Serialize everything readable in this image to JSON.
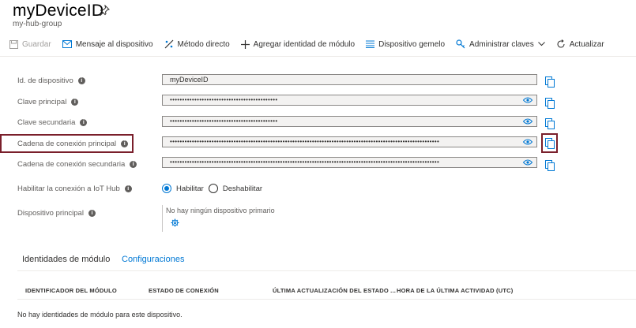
{
  "header": {
    "title": "myDeviceID",
    "subtitle": "my-hub-group"
  },
  "toolbar": {
    "save": "Guardar",
    "message": "Mensaje al dispositivo",
    "direct_method": "Método directo",
    "add_module": "Agregar identidad de módulo",
    "twin": "Dispositivo gemelo",
    "manage_keys": "Administrar claves",
    "refresh": "Actualizar"
  },
  "fields": {
    "device_id": {
      "label": "Id. de dispositivo",
      "value": "myDeviceID"
    },
    "primary_key": {
      "label": "Clave principal",
      "value": "••••••••••••••••••••••••••••••••••••••••••••"
    },
    "secondary_key": {
      "label": "Clave secundaria",
      "value": "••••••••••••••••••••••••••••••••••••••••••••"
    },
    "primary_conn": {
      "label": "Cadena de conexión principal",
      "value": "••••••••••••••••••••••••••••••••••••••••••••••••••••••••••••••••••••••••••••••••••••••••••••••••••••••••••••••"
    },
    "secondary_conn": {
      "label": "Cadena de conexión secundaria",
      "value": "••••••••••••••••••••••••••••••••••••••••••••••••••••••••••••••••••••••••••••••••••••••••••••••••••••••••••••••"
    }
  },
  "iot_hub": {
    "label": "Habilitar la conexión a IoT Hub",
    "enable": "Habilitar",
    "disable": "Deshabilitar",
    "selected": "Habilitar"
  },
  "parent": {
    "label": "Dispositivo principal",
    "value": "No hay ningún dispositivo primario"
  },
  "tabs": {
    "modules": "Identidades de módulo",
    "configs": "Configuraciones"
  },
  "table": {
    "headers": [
      "IDENTIFICADOR DEL MÓDULO",
      "ESTADO DE CONEXIÓN",
      "ÚLTIMA ACTUALIZACIÓN DEL ESTADO ...",
      "HORA DE LA ÚLTIMA ACTIVIDAD (UTC)"
    ],
    "empty": "No hay identidades de módulo para este dispositivo."
  },
  "colors": {
    "accent": "#0078d4",
    "highlight": "#7a1f2b"
  }
}
